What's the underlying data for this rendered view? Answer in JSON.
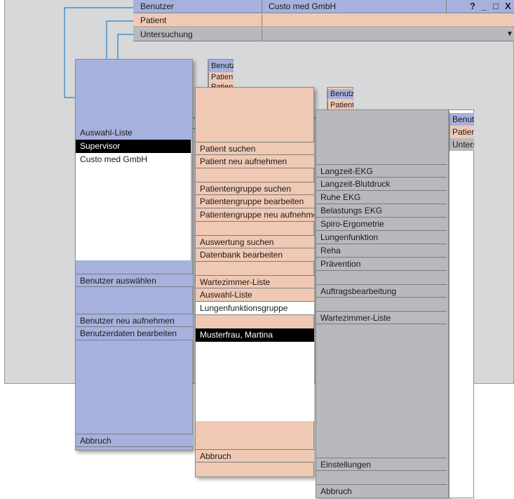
{
  "window": {
    "benutzer_label": "Benutzer",
    "benutzer_value": "Custo med GmbH",
    "patient_label": "Patient",
    "untersuchung_label": "Untersuchung",
    "help_btn": "?",
    "minimize_btn": "_",
    "maximize_btn": "□",
    "close_btn": "X",
    "dropdown_arrow": "▼"
  },
  "panel1": {
    "tab_benutzer": "Benutzer",
    "tab_patient": "Patient",
    "tab_untersuchung": "Patient",
    "auswahl_liste": "Auswahl-Liste",
    "list": [
      "Supervisor",
      "Custo med GmbH"
    ],
    "btn_select": "Benutzer auswählen",
    "btn_new": "Benutzer neu aufnehmen",
    "btn_edit": "Benutzerdaten bearbeiten",
    "btn_cancel": "Abbruch"
  },
  "panel2": {
    "tab_benutzer": "Benutzer",
    "tab_patient": "Patient",
    "btn_search": "Patient suchen",
    "btn_new": "Patient neu aufnehmen",
    "btn_group_search": "Patientengruppe suchen",
    "btn_group_edit": "Patientengruppe bearbeiten",
    "btn_group_new": "Patientengruppe neu aufnehmen",
    "btn_eval": "Auswertung suchen",
    "btn_db": "Datenbank bearbeiten",
    "btn_waiting": "Wartezimmer-Liste",
    "btn_list": "Auswahl-Liste",
    "group_field": "Lungenfunktionsgruppe",
    "list": [
      "Musterfrau, Martina"
    ],
    "btn_cancel": "Abbruch"
  },
  "panel3": {
    "tab_benutzer": "Benutzer",
    "tab_patient": "Patient",
    "tab_untersuchung": "Untersuchung",
    "exams": [
      "Langzeit-EKG",
      "Langzeit-Blutdruck",
      "Ruhe EKG",
      "Belastungs EKG",
      "Spiro-Ergometrie",
      "Lungenfunktion",
      "Reha",
      "Prävention"
    ],
    "btn_orders": "Auftragsbearbeitung",
    "btn_waiting": "Wartezimmer-Liste",
    "btn_settings": "Einstellungen",
    "btn_cancel": "Abbruch"
  },
  "colors": {
    "benutzer": "#a7b1de",
    "patient": "#f0c9b4",
    "untersuchung": "#b8b9bd",
    "arrow": "#2a7fc0",
    "selected": "#000000"
  }
}
